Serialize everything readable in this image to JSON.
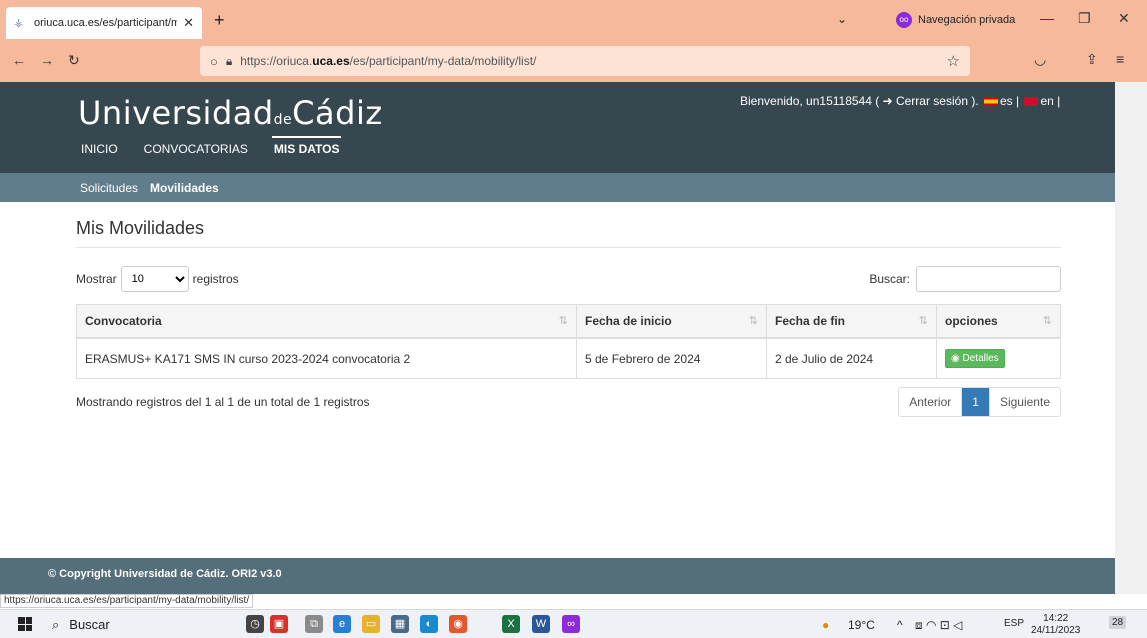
{
  "browser": {
    "tab_title": "oriuca.uca.es/es/participant/my ✕",
    "tab_title_text": "oriuca.uca.es/es/participant/my",
    "new_tab": "+",
    "private_label": "Navegación privada",
    "url_prefix": "https://oriuca.",
    "url_domain": "uca.es",
    "url_suffix": "/es/participant/my-data/mobility/list/",
    "status_url": "https://oriuca.uca.es/es/participant/my-data/mobility/list/"
  },
  "site": {
    "logo_main": "Universidad",
    "logo_de": "de",
    "logo_end": "Cádiz",
    "welcome_prefix": "Bienvenido, un15118544 ( ",
    "logout_label": "Cerrar sesión",
    "lang_es": "es",
    "lang_en": "en",
    "nav": [
      "INICIO",
      "CONVOCATORIAS",
      "MIS DATOS"
    ],
    "subnav": [
      "Solicitudes",
      "Movilidades"
    ]
  },
  "main": {
    "title": "Mis Movilidades",
    "show_label": "Mostrar",
    "show_value": "10",
    "records_label": "registros",
    "search_label": "Buscar:",
    "columns": [
      "Convocatoria",
      "Fecha de inicio",
      "Fecha de fin",
      "opciones"
    ],
    "rows": [
      {
        "convocatoria": "ERASMUS+ KA171 SMS IN curso 2023-2024 convocatoria 2",
        "inicio": "5 de Febrero de 2024",
        "fin": "2 de Julio de 2024",
        "action": "Detalles"
      }
    ],
    "info": "Mostrando registros del 1 al 1 de un total de 1 registros",
    "prev": "Anterior",
    "page": "1",
    "next": "Siguiente"
  },
  "footer": {
    "text": "© Copyright Universidad de Cádiz. ORI2 v3.0"
  },
  "taskbar": {
    "search": "Buscar",
    "weather": "19°C",
    "lang": "ESP",
    "time": "14:22",
    "date": "24/11/2023",
    "notif": "28"
  },
  "colors": {
    "header": "#37474f",
    "subnav": "#607d8b",
    "footer": "#546e7a",
    "chrome": "#f6b99b",
    "success": "#5cb85c",
    "primary": "#337ab7"
  }
}
